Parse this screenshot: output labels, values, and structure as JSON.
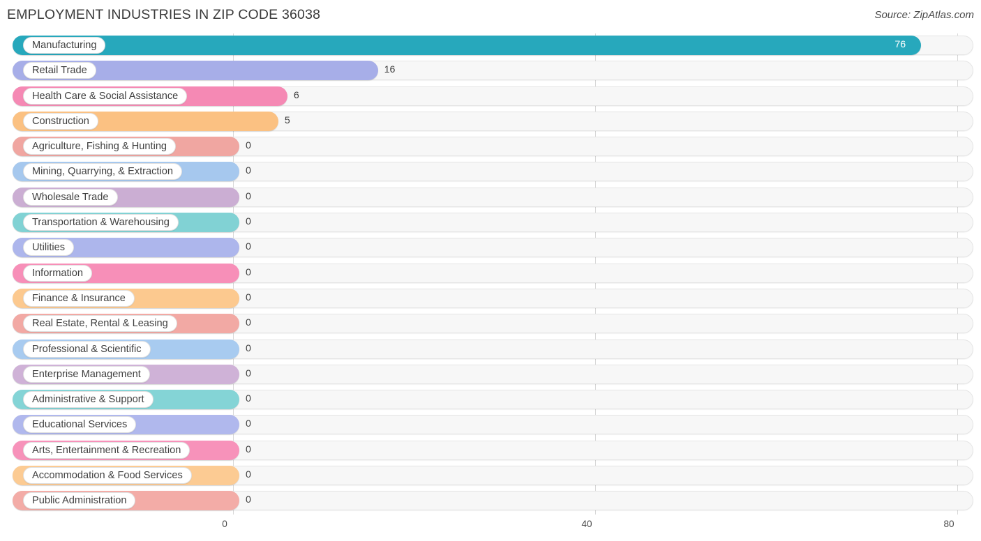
{
  "header": {
    "title": "EMPLOYMENT INDUSTRIES IN ZIP CODE 36038",
    "source": "Source: ZipAtlas.com"
  },
  "chart_data": {
    "type": "bar",
    "orientation": "horizontal",
    "title": "EMPLOYMENT INDUSTRIES IN ZIP CODE 36038",
    "xlabel": "",
    "ylabel": "",
    "xlim": [
      0,
      80
    ],
    "xticks": [
      0,
      40,
      80
    ],
    "xtick_labels": [
      "0",
      "40",
      "80"
    ],
    "grid": true,
    "legend": false,
    "categories": [
      "Manufacturing",
      "Retail Trade",
      "Health Care & Social Assistance",
      "Construction",
      "Agriculture, Fishing & Hunting",
      "Mining, Quarrying, & Extraction",
      "Wholesale Trade",
      "Transportation & Warehousing",
      "Utilities",
      "Information",
      "Finance & Insurance",
      "Real Estate, Rental & Leasing",
      "Professional & Scientific",
      "Enterprise Management",
      "Administrative & Support",
      "Educational Services",
      "Arts, Entertainment & Recreation",
      "Accommodation & Food Services",
      "Public Administration"
    ],
    "values": [
      76,
      16,
      6,
      5,
      0,
      0,
      0,
      0,
      0,
      0,
      0,
      0,
      0,
      0,
      0,
      0,
      0,
      0,
      0
    ],
    "value_labels": [
      "76",
      "16",
      "6",
      "5",
      "0",
      "0",
      "0",
      "0",
      "0",
      "0",
      "0",
      "0",
      "0",
      "0",
      "0",
      "0",
      "0",
      "0",
      "0"
    ],
    "bar_colors": [
      "#27a8bc",
      "#a7aee8",
      "#f589b4",
      "#fbc182",
      "#f0a6a1",
      "#a6c8ee",
      "#cbaed3",
      "#81d2d4",
      "#adb6ec",
      "#f78fb8",
      "#fcc98f",
      "#f2a9a4",
      "#a8cbf0",
      "#cfb2d7",
      "#84d4d6",
      "#b0b8ed",
      "#f792ba",
      "#fccb93",
      "#f3aca7"
    ],
    "track_color": "#f7f7f7",
    "gridline_color": "#d8d8d8"
  }
}
